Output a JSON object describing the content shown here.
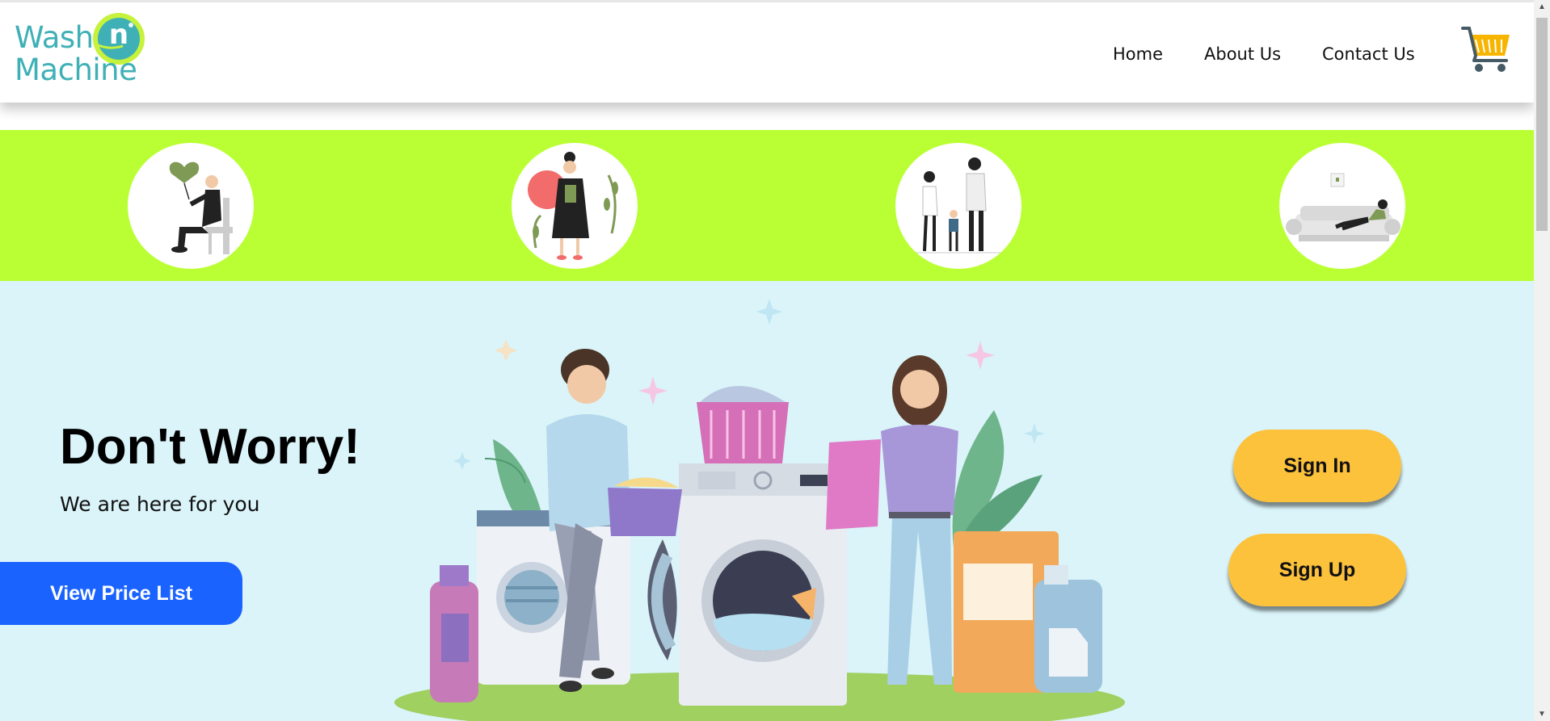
{
  "brand": {
    "line1": "Wash",
    "badge": "n",
    "line2": "Machine",
    "color": "#3fb0b6",
    "ring_color": "#c6f23c"
  },
  "nav": {
    "home": "Home",
    "about": "About Us",
    "contact": "Contact Us"
  },
  "cart": {
    "icon": "shopping-cart-icon",
    "color": "#f7b500"
  },
  "band": {
    "color": "#b9ff33"
  },
  "hero": {
    "title": "Don't Worry!",
    "subtitle": "We are here for you",
    "price_button": "View Price List",
    "sign_in": "Sign In",
    "sign_up": "Sign Up",
    "background": "#daf4f9"
  },
  "colors": {
    "primary_button": "#1a63ff",
    "pill_button": "#fdc23c"
  }
}
